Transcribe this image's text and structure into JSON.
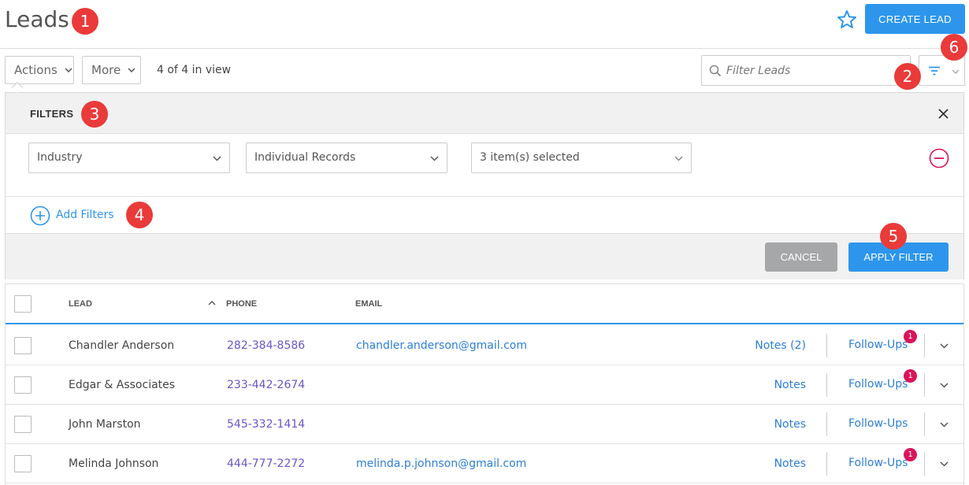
{
  "header": {
    "title": "Leads",
    "create_label": "CREATE LEAD"
  },
  "toolbar": {
    "actions_label": "Actions",
    "more_label": "More",
    "view_count": "4 of 4 in view",
    "search_placeholder": "Filter Leads"
  },
  "filters": {
    "title": "FILTERS",
    "field": "Industry",
    "scope": "Individual Records",
    "selection": "3 item(s) selected",
    "add_label": "Add Filters",
    "cancel_label": "CANCEL",
    "apply_label": "APPLY FILTER"
  },
  "table": {
    "columns": [
      "LEAD",
      "PHONE",
      "EMAIL"
    ],
    "rows": [
      {
        "name": "Chandler Anderson",
        "phone": "282-384-8586",
        "email": "chandler.anderson@gmail.com",
        "notes": "Notes (2)",
        "followups": "Follow-Ups",
        "badge": "1"
      },
      {
        "name": "Edgar & Associates",
        "phone": "233-442-2674",
        "email": "",
        "notes": "Notes",
        "followups": "Follow-Ups",
        "badge": "1"
      },
      {
        "name": "John Marston",
        "phone": "545-332-1414",
        "email": "",
        "notes": "Notes",
        "followups": "Follow-Ups",
        "badge": ""
      },
      {
        "name": "Melinda Johnson",
        "phone": "444-777-2272",
        "email": "melinda.p.johnson@gmail.com",
        "notes": "Notes",
        "followups": "Follow-Ups",
        "badge": "1"
      }
    ]
  },
  "annotations": [
    "1",
    "2",
    "3",
    "4",
    "5",
    "6"
  ],
  "colors": {
    "accent": "#2d96ec",
    "marker": "#ea3a3a",
    "badge": "#d9145a",
    "remove": "#d9145a"
  }
}
